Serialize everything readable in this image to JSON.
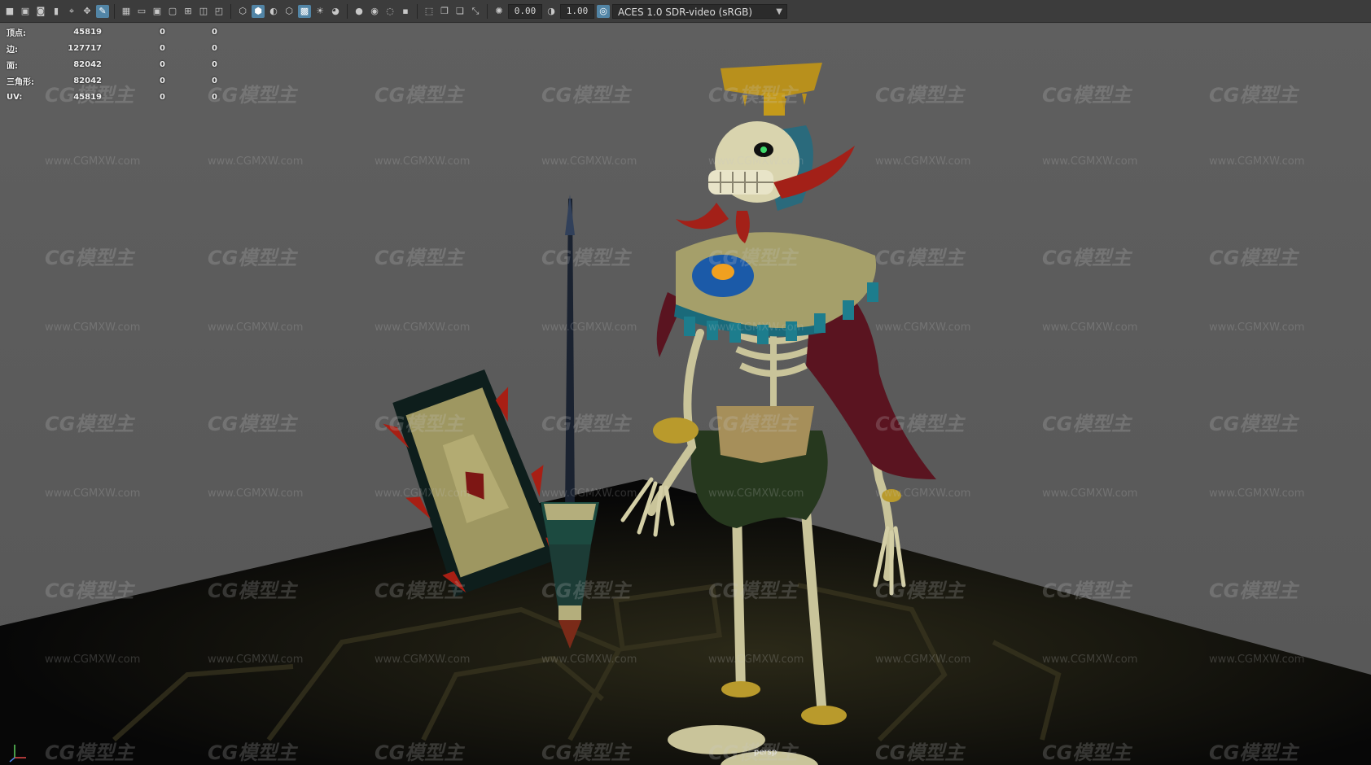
{
  "toolbar": {
    "exposure_value": "0.00",
    "gamma_value": "1.00",
    "color_management": "ACES 1.0 SDR-video (sRGB)"
  },
  "hud": {
    "rows": [
      {
        "label": "顶点:",
        "v0": "45819",
        "v1": "0",
        "v2": "0"
      },
      {
        "label": "边:",
        "v0": "127717",
        "v1": "0",
        "v2": "0"
      },
      {
        "label": "面:",
        "v0": "82042",
        "v1": "0",
        "v2": "0"
      },
      {
        "label": "三角形:",
        "v0": "82042",
        "v1": "0",
        "v2": "0"
      },
      {
        "label": "UV:",
        "v0": "45819",
        "v1": "0",
        "v2": "0"
      }
    ]
  },
  "viewport": {
    "camera": "persp",
    "watermark_logo": "CG模型主",
    "watermark_url": "www.CGMXW.com"
  },
  "colors": {
    "background": "#5b5b5b",
    "toolbar": "#3c3c3c",
    "active_button": "#5285a6"
  }
}
